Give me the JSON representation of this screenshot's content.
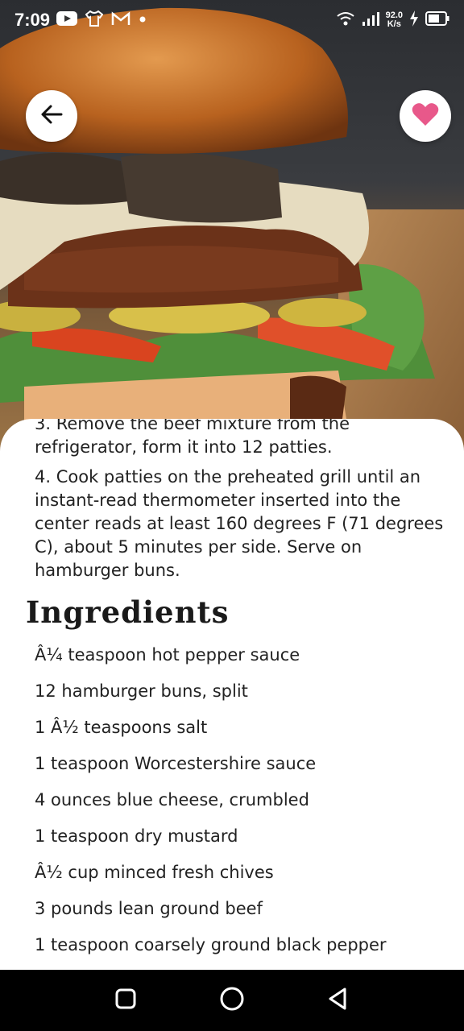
{
  "status_bar": {
    "time": "7:09",
    "net_speed_value": "92.0",
    "net_speed_unit": "K/s",
    "icons": [
      "youtube-icon",
      "shirt-icon",
      "gmail-icon",
      "dot-icon",
      "wifi-icon",
      "signal-icon",
      "charging-icon",
      "battery-icon"
    ]
  },
  "header": {
    "back_icon": "arrow-left-icon",
    "favorite_icon": "heart-icon",
    "favorite_color": "#e8588a"
  },
  "recipe": {
    "steps": [
      "3. Remove the beef mixture from the refrigerator, form it into 12 patties.",
      "4. Cook patties on the preheated grill until an instant-read thermometer inserted into the center reads at least 160 degrees F (71 degrees C), about 5 minutes per side. Serve on hamburger buns."
    ],
    "ingredients_title": "Ingredients",
    "ingredients": [
      "Â¼ teaspoon hot pepper sauce",
      "12 hamburger buns, split",
      "1 Â½ teaspoons salt",
      "1 teaspoon Worcestershire sauce",
      "4 ounces blue cheese, crumbled",
      "1 teaspoon dry mustard",
      "Â½ cup minced fresh chives",
      "3 pounds lean ground beef",
      "1 teaspoon coarsely ground black pepper"
    ]
  },
  "nav_bar": {
    "icons": [
      "recents-square-icon",
      "home-circle-icon",
      "back-triangle-icon"
    ]
  }
}
